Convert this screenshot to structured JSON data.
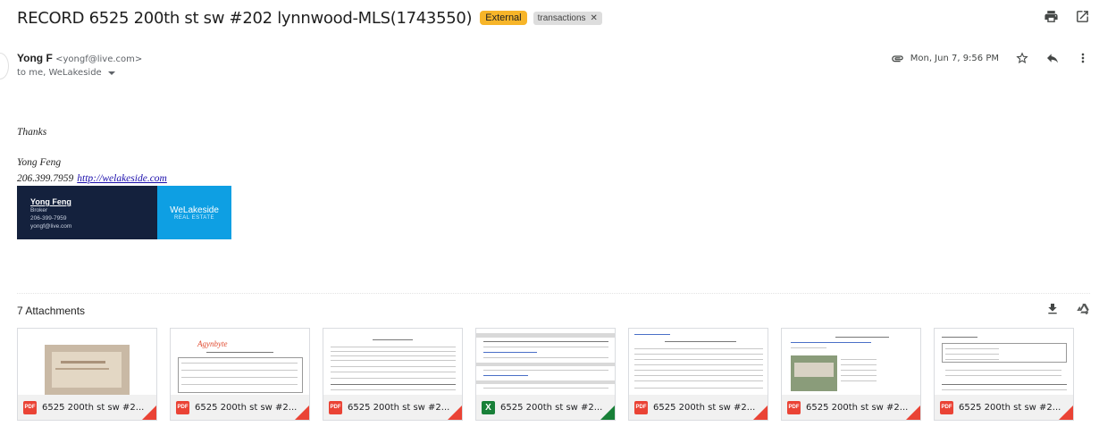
{
  "email": {
    "subject": "RECORD 6525 200th st sw #202 lynnwood-MLS(1743550)",
    "labels": [
      {
        "text": "External",
        "color": "#f7b529"
      },
      {
        "text": "transactions",
        "color": "#dddddd"
      }
    ],
    "sender_name": "Yong F",
    "sender_email": "<yongf@live.com>",
    "to_line": "to me, WeLakeside",
    "date": "Mon, Jun 7, 9:56 PM"
  },
  "body": {
    "thanks": "Thanks",
    "sig_name": "Yong Feng",
    "sig_phone": "206.399.7959",
    "sig_link": "http://welakeside.com"
  },
  "card": {
    "name": "Yong Feng",
    "title": "Broker",
    "phone": "206-399-7959",
    "email": "yongf@live.com",
    "brand": "WeLakeside",
    "brand_sub": "REAL ESTATE",
    "colors": {
      "left": "#14213d",
      "right": "#0e9fe3"
    }
  },
  "attachments": {
    "header": "7 Attachments",
    "files": [
      {
        "name": "6525 200th st sw #2...",
        "type": "PDF",
        "icon": "pdf-icon"
      },
      {
        "name": "6525 200th st sw #2...",
        "type": "PDF",
        "icon": "pdf-icon"
      },
      {
        "name": "6525 200th st sw #2...",
        "type": "PDF",
        "icon": "pdf-icon"
      },
      {
        "name": "6525 200th st sw #2...",
        "type": "X",
        "icon": "sheets-icon"
      },
      {
        "name": "6525 200th st sw #2...",
        "type": "PDF",
        "icon": "pdf-icon"
      },
      {
        "name": "6525 200th st sw #2...",
        "type": "PDF",
        "icon": "pdf-icon"
      },
      {
        "name": "6525 200th st sw #2...",
        "type": "PDF",
        "icon": "pdf-icon"
      }
    ],
    "thumb_texts": {
      "t2_logo": "Agynbyte"
    }
  }
}
